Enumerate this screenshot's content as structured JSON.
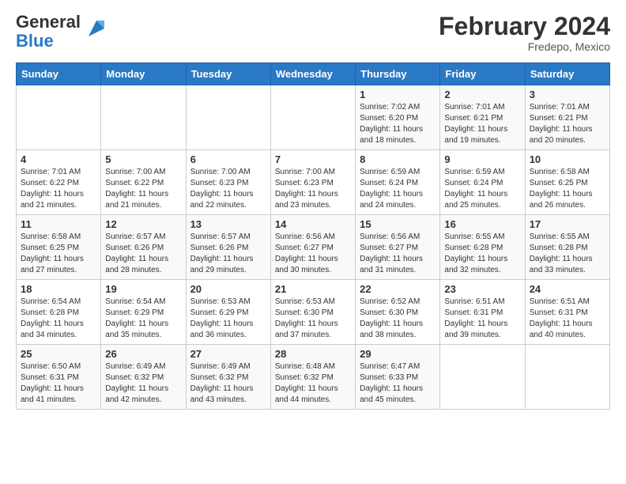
{
  "header": {
    "logo_general": "General",
    "logo_blue": "Blue",
    "title": "February 2024",
    "subtitle": "Fredepo, Mexico"
  },
  "days_of_week": [
    "Sunday",
    "Monday",
    "Tuesday",
    "Wednesday",
    "Thursday",
    "Friday",
    "Saturday"
  ],
  "weeks": [
    [
      {
        "day": null
      },
      {
        "day": null
      },
      {
        "day": null
      },
      {
        "day": null
      },
      {
        "day": "1",
        "sunrise": "7:02 AM",
        "sunset": "6:20 PM",
        "daylight": "11 hours and 18 minutes."
      },
      {
        "day": "2",
        "sunrise": "7:01 AM",
        "sunset": "6:21 PM",
        "daylight": "11 hours and 19 minutes."
      },
      {
        "day": "3",
        "sunrise": "7:01 AM",
        "sunset": "6:21 PM",
        "daylight": "11 hours and 20 minutes."
      }
    ],
    [
      {
        "day": "4",
        "sunrise": "7:01 AM",
        "sunset": "6:22 PM",
        "daylight": "11 hours and 21 minutes."
      },
      {
        "day": "5",
        "sunrise": "7:00 AM",
        "sunset": "6:22 PM",
        "daylight": "11 hours and 21 minutes."
      },
      {
        "day": "6",
        "sunrise": "7:00 AM",
        "sunset": "6:23 PM",
        "daylight": "11 hours and 22 minutes."
      },
      {
        "day": "7",
        "sunrise": "7:00 AM",
        "sunset": "6:23 PM",
        "daylight": "11 hours and 23 minutes."
      },
      {
        "day": "8",
        "sunrise": "6:59 AM",
        "sunset": "6:24 PM",
        "daylight": "11 hours and 24 minutes."
      },
      {
        "day": "9",
        "sunrise": "6:59 AM",
        "sunset": "6:24 PM",
        "daylight": "11 hours and 25 minutes."
      },
      {
        "day": "10",
        "sunrise": "6:58 AM",
        "sunset": "6:25 PM",
        "daylight": "11 hours and 26 minutes."
      }
    ],
    [
      {
        "day": "11",
        "sunrise": "6:58 AM",
        "sunset": "6:25 PM",
        "daylight": "11 hours and 27 minutes."
      },
      {
        "day": "12",
        "sunrise": "6:57 AM",
        "sunset": "6:26 PM",
        "daylight": "11 hours and 28 minutes."
      },
      {
        "day": "13",
        "sunrise": "6:57 AM",
        "sunset": "6:26 PM",
        "daylight": "11 hours and 29 minutes."
      },
      {
        "day": "14",
        "sunrise": "6:56 AM",
        "sunset": "6:27 PM",
        "daylight": "11 hours and 30 minutes."
      },
      {
        "day": "15",
        "sunrise": "6:56 AM",
        "sunset": "6:27 PM",
        "daylight": "11 hours and 31 minutes."
      },
      {
        "day": "16",
        "sunrise": "6:55 AM",
        "sunset": "6:28 PM",
        "daylight": "11 hours and 32 minutes."
      },
      {
        "day": "17",
        "sunrise": "6:55 AM",
        "sunset": "6:28 PM",
        "daylight": "11 hours and 33 minutes."
      }
    ],
    [
      {
        "day": "18",
        "sunrise": "6:54 AM",
        "sunset": "6:28 PM",
        "daylight": "11 hours and 34 minutes."
      },
      {
        "day": "19",
        "sunrise": "6:54 AM",
        "sunset": "6:29 PM",
        "daylight": "11 hours and 35 minutes."
      },
      {
        "day": "20",
        "sunrise": "6:53 AM",
        "sunset": "6:29 PM",
        "daylight": "11 hours and 36 minutes."
      },
      {
        "day": "21",
        "sunrise": "6:53 AM",
        "sunset": "6:30 PM",
        "daylight": "11 hours and 37 minutes."
      },
      {
        "day": "22",
        "sunrise": "6:52 AM",
        "sunset": "6:30 PM",
        "daylight": "11 hours and 38 minutes."
      },
      {
        "day": "23",
        "sunrise": "6:51 AM",
        "sunset": "6:31 PM",
        "daylight": "11 hours and 39 minutes."
      },
      {
        "day": "24",
        "sunrise": "6:51 AM",
        "sunset": "6:31 PM",
        "daylight": "11 hours and 40 minutes."
      }
    ],
    [
      {
        "day": "25",
        "sunrise": "6:50 AM",
        "sunset": "6:31 PM",
        "daylight": "11 hours and 41 minutes."
      },
      {
        "day": "26",
        "sunrise": "6:49 AM",
        "sunset": "6:32 PM",
        "daylight": "11 hours and 42 minutes."
      },
      {
        "day": "27",
        "sunrise": "6:49 AM",
        "sunset": "6:32 PM",
        "daylight": "11 hours and 43 minutes."
      },
      {
        "day": "28",
        "sunrise": "6:48 AM",
        "sunset": "6:32 PM",
        "daylight": "11 hours and 44 minutes."
      },
      {
        "day": "29",
        "sunrise": "6:47 AM",
        "sunset": "6:33 PM",
        "daylight": "11 hours and 45 minutes."
      },
      {
        "day": null
      },
      {
        "day": null
      }
    ]
  ]
}
